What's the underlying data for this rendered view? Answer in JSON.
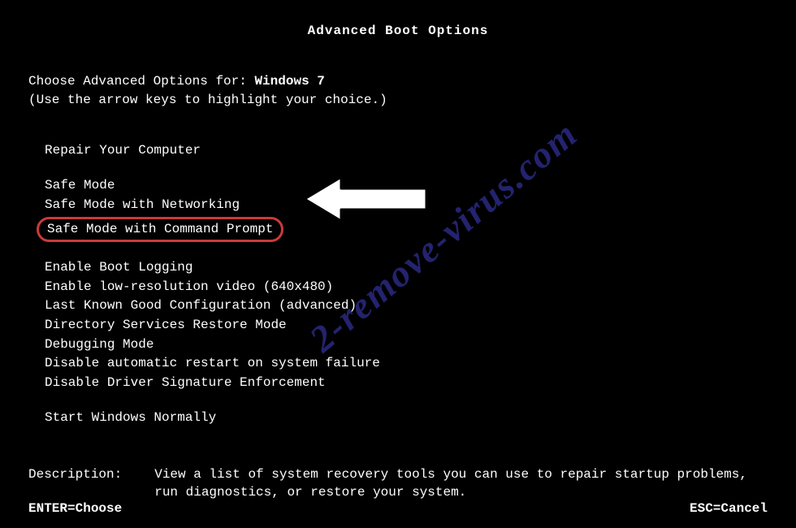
{
  "title": "Advanced Boot Options",
  "prompt_prefix": "Choose Advanced Options for: ",
  "os_name": "Windows 7",
  "hint": "(Use the arrow keys to highlight your choice.)",
  "menu": {
    "repair": "Repair Your Computer",
    "safe_mode": "Safe Mode",
    "safe_mode_net": "Safe Mode with Networking",
    "safe_mode_cmd": "Safe Mode with Command Prompt",
    "boot_logging": "Enable Boot Logging",
    "low_res": "Enable low-resolution video (640x480)",
    "lkgc": "Last Known Good Configuration (advanced)",
    "ds_restore": "Directory Services Restore Mode",
    "debug": "Debugging Mode",
    "no_auto_restart": "Disable automatic restart on system failure",
    "no_sig_enforce": "Disable Driver Signature Enforcement",
    "start_normal": "Start Windows Normally"
  },
  "description": {
    "label": "Description:",
    "text": "View a list of system recovery tools you can use to repair startup problems, run diagnostics, or restore your system."
  },
  "footer": {
    "enter": "ENTER=Choose",
    "esc": "ESC=Cancel"
  },
  "watermark": "2-remove-virus.com",
  "colors": {
    "highlight_border": "#c93b3b",
    "watermark": "#2e2d8f"
  }
}
